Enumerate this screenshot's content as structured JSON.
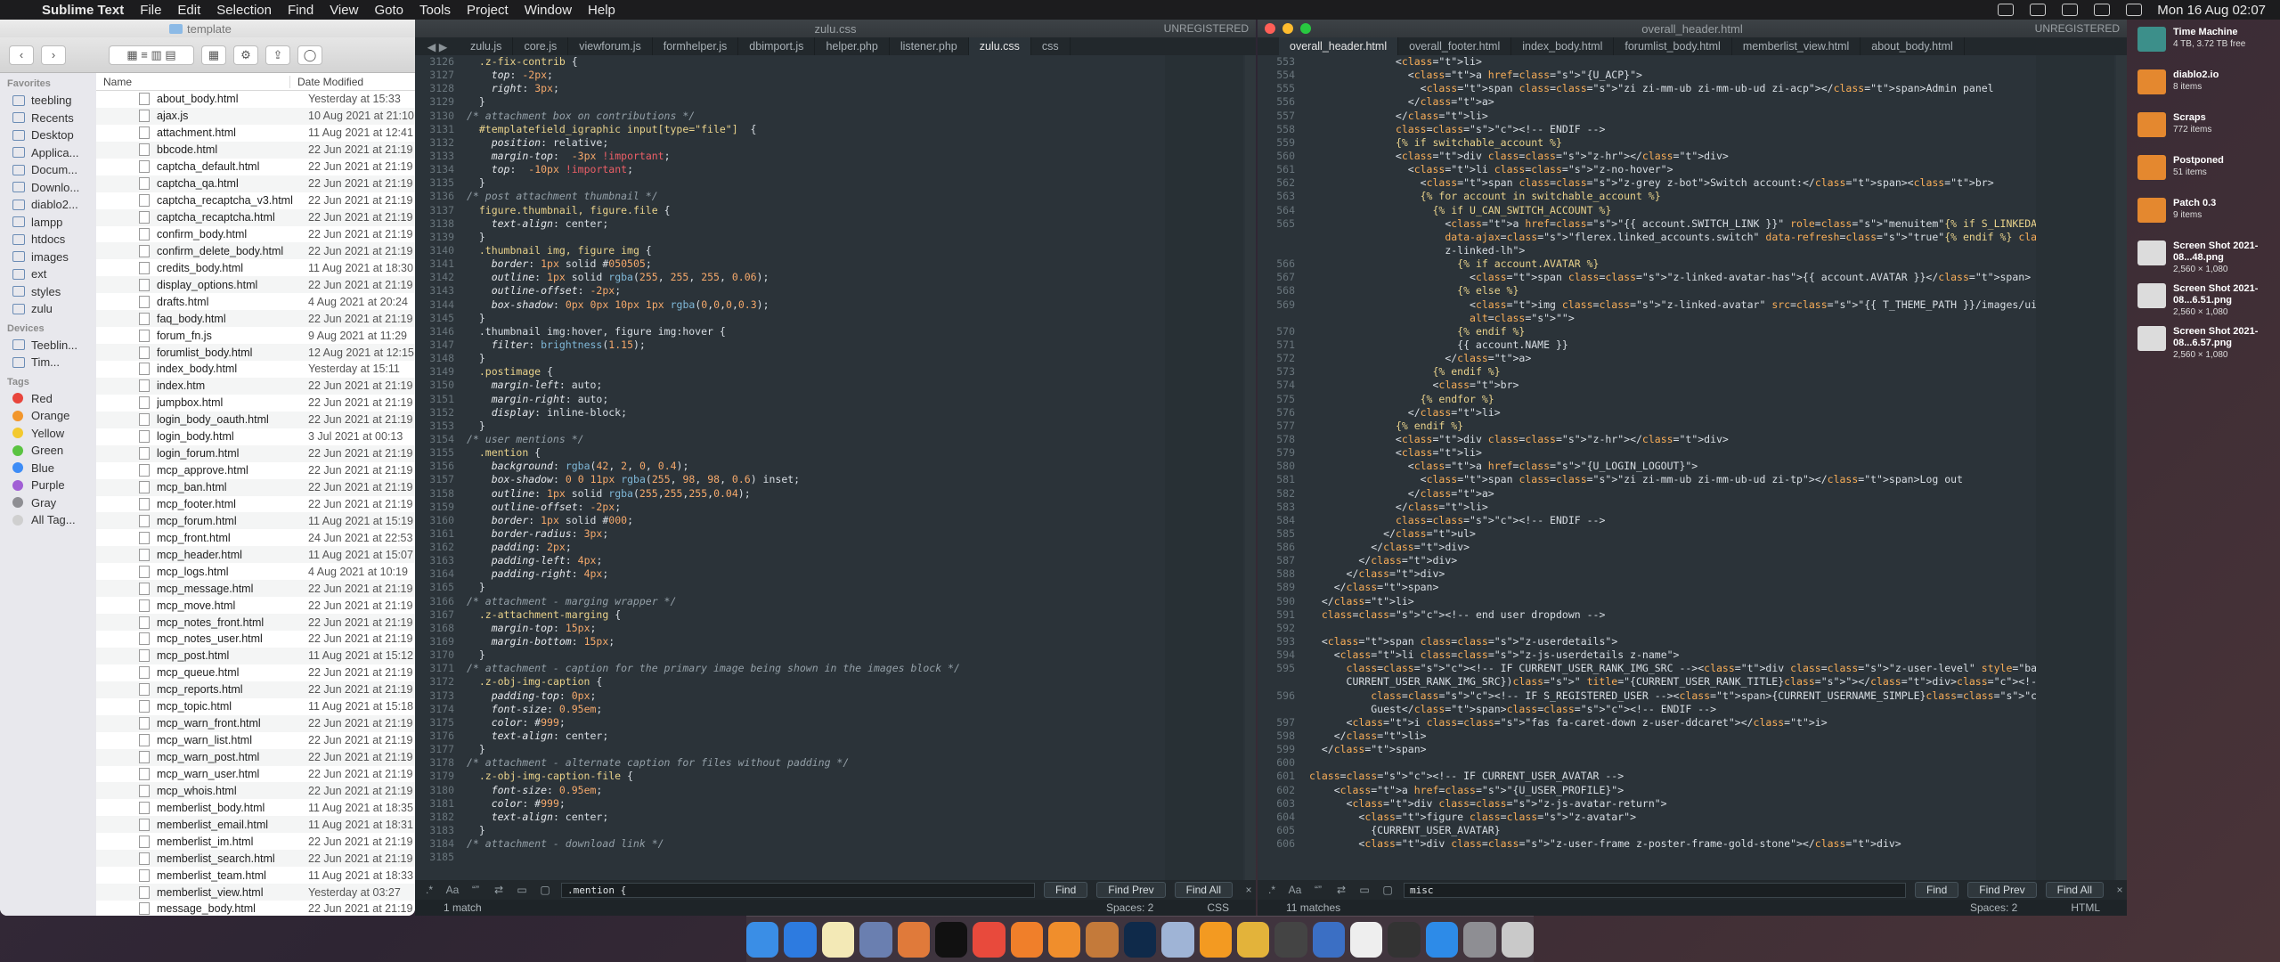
{
  "menubar": {
    "app": "Sublime Text",
    "menus": [
      "File",
      "Edit",
      "Selection",
      "Find",
      "View",
      "Goto",
      "Tools",
      "Project",
      "Window",
      "Help"
    ],
    "clock": "Mon 16 Aug  02:07"
  },
  "finder": {
    "title": "template",
    "columns": {
      "name": "Name",
      "date": "Date Modified"
    },
    "sidebar": {
      "favorites_label": "Favorites",
      "favorites": [
        "teebling",
        "Recents",
        "Desktop",
        "Applica...",
        "Docum...",
        "Downlo...",
        "diablo2...",
        "lampp",
        "htdocs",
        "images",
        "ext",
        "styles",
        "zulu"
      ],
      "devices_label": "Devices",
      "devices": [
        "Teeblin...",
        "Tim..."
      ],
      "tags_label": "Tags",
      "tags": [
        {
          "name": "Red",
          "color": "#e8453c"
        },
        {
          "name": "Orange",
          "color": "#f2962c"
        },
        {
          "name": "Yellow",
          "color": "#f3c92e"
        },
        {
          "name": "Green",
          "color": "#5ac341"
        },
        {
          "name": "Blue",
          "color": "#3d8cf6"
        },
        {
          "name": "Purple",
          "color": "#a15fd5"
        },
        {
          "name": "Gray",
          "color": "#8e8e93"
        },
        {
          "name": "All Tag...",
          "color": "#cfcfcf"
        }
      ]
    },
    "files": [
      {
        "name": "about_body.html",
        "date": "Yesterday at 15:33"
      },
      {
        "name": "ajax.js",
        "date": "10 Aug 2021 at 21:10"
      },
      {
        "name": "attachment.html",
        "date": "11 Aug 2021 at 12:41"
      },
      {
        "name": "bbcode.html",
        "date": "22 Jun 2021 at 21:19"
      },
      {
        "name": "captcha_default.html",
        "date": "22 Jun 2021 at 21:19"
      },
      {
        "name": "captcha_qa.html",
        "date": "22 Jun 2021 at 21:19"
      },
      {
        "name": "captcha_recaptcha_v3.html",
        "date": "22 Jun 2021 at 21:19"
      },
      {
        "name": "captcha_recaptcha.html",
        "date": "22 Jun 2021 at 21:19"
      },
      {
        "name": "confirm_body.html",
        "date": "22 Jun 2021 at 21:19"
      },
      {
        "name": "confirm_delete_body.html",
        "date": "22 Jun 2021 at 21:19"
      },
      {
        "name": "credits_body.html",
        "date": "11 Aug 2021 at 18:30"
      },
      {
        "name": "display_options.html",
        "date": "22 Jun 2021 at 21:19"
      },
      {
        "name": "drafts.html",
        "date": "4 Aug 2021 at 20:24"
      },
      {
        "name": "faq_body.html",
        "date": "22 Jun 2021 at 21:19"
      },
      {
        "name": "forum_fn.js",
        "date": "9 Aug 2021 at 11:29"
      },
      {
        "name": "forumlist_body.html",
        "date": "12 Aug 2021 at 12:15"
      },
      {
        "name": "index_body.html",
        "date": "Yesterday at 15:11"
      },
      {
        "name": "index.htm",
        "date": "22 Jun 2021 at 21:19"
      },
      {
        "name": "jumpbox.html",
        "date": "22 Jun 2021 at 21:19"
      },
      {
        "name": "login_body_oauth.html",
        "date": "22 Jun 2021 at 21:19"
      },
      {
        "name": "login_body.html",
        "date": "3 Jul 2021 at 00:13"
      },
      {
        "name": "login_forum.html",
        "date": "22 Jun 2021 at 21:19"
      },
      {
        "name": "mcp_approve.html",
        "date": "22 Jun 2021 at 21:19"
      },
      {
        "name": "mcp_ban.html",
        "date": "22 Jun 2021 at 21:19"
      },
      {
        "name": "mcp_footer.html",
        "date": "22 Jun 2021 at 21:19"
      },
      {
        "name": "mcp_forum.html",
        "date": "11 Aug 2021 at 15:19"
      },
      {
        "name": "mcp_front.html",
        "date": "24 Jun 2021 at 22:53"
      },
      {
        "name": "mcp_header.html",
        "date": "11 Aug 2021 at 15:07"
      },
      {
        "name": "mcp_logs.html",
        "date": "4 Aug 2021 at 10:19"
      },
      {
        "name": "mcp_message.html",
        "date": "22 Jun 2021 at 21:19"
      },
      {
        "name": "mcp_move.html",
        "date": "22 Jun 2021 at 21:19"
      },
      {
        "name": "mcp_notes_front.html",
        "date": "22 Jun 2021 at 21:19"
      },
      {
        "name": "mcp_notes_user.html",
        "date": "22 Jun 2021 at 21:19"
      },
      {
        "name": "mcp_post.html",
        "date": "11 Aug 2021 at 15:12"
      },
      {
        "name": "mcp_queue.html",
        "date": "22 Jun 2021 at 21:19"
      },
      {
        "name": "mcp_reports.html",
        "date": "22 Jun 2021 at 21:19"
      },
      {
        "name": "mcp_topic.html",
        "date": "11 Aug 2021 at 15:18"
      },
      {
        "name": "mcp_warn_front.html",
        "date": "22 Jun 2021 at 21:19"
      },
      {
        "name": "mcp_warn_list.html",
        "date": "22 Jun 2021 at 21:19"
      },
      {
        "name": "mcp_warn_post.html",
        "date": "22 Jun 2021 at 21:19"
      },
      {
        "name": "mcp_warn_user.html",
        "date": "22 Jun 2021 at 21:19"
      },
      {
        "name": "mcp_whois.html",
        "date": "22 Jun 2021 at 21:19"
      },
      {
        "name": "memberlist_body.html",
        "date": "11 Aug 2021 at 18:35"
      },
      {
        "name": "memberlist_email.html",
        "date": "11 Aug 2021 at 18:31"
      },
      {
        "name": "memberlist_im.html",
        "date": "22 Jun 2021 at 21:19"
      },
      {
        "name": "memberlist_search.html",
        "date": "22 Jun 2021 at 21:19"
      },
      {
        "name": "memberlist_team.html",
        "date": "11 Aug 2021 at 18:33"
      },
      {
        "name": "memberlist_view.html",
        "date": "Yesterday at 03:27"
      },
      {
        "name": "message_body.html",
        "date": "22 Jun 2021 at 21:19"
      }
    ]
  },
  "editor_left": {
    "window_title": "zulu.css",
    "unregistered": "UNREGISTERED",
    "tabs": [
      "zulu.js",
      "core.js",
      "viewforum.js",
      "formhelper.js",
      "dbimport.js",
      "helper.php",
      "listener.php",
      "zulu.css",
      "css"
    ],
    "active_tab": "zulu.css",
    "find_value": ".mention {",
    "find_buttons": [
      "Find",
      "Find Prev",
      "Find All"
    ],
    "status": {
      "matches": "1 match",
      "spaces": "Spaces: 2",
      "syntax": "CSS"
    },
    "line_numbers": [
      "3126",
      "3127",
      "3128",
      "3129",
      "3130",
      "3131",
      "3132",
      "3133",
      "3134",
      "3135",
      "3136",
      "3137",
      "3138",
      "3139",
      "3140",
      "3141",
      "3142",
      "3143",
      "3144",
      "3145",
      "3146",
      "3147",
      "3148",
      "3149",
      "3150",
      "3151",
      "3152",
      "3153",
      "3154",
      "3155",
      "3156",
      "3157",
      "3158",
      "3159",
      "3160",
      "3161",
      "3162",
      "3163",
      "3164",
      "3165",
      "3166",
      "3167",
      "3168",
      "3169",
      "3170",
      "3171",
      "3172",
      "3173",
      "3174",
      "3175",
      "3176",
      "3177",
      "3178",
      "3179",
      "3180",
      "3181",
      "3182",
      "3183",
      "3184",
      "3185"
    ],
    "lines": [
      "  .z-fix-contrib {",
      "    top: -2px;",
      "    right: 3px;",
      "  }",
      "/* attachment box on contributions */",
      "  #templatefield_igraphic input[type=\"file\"]  {",
      "    position: relative;",
      "    margin-top:  -3px !important;",
      "    top:  -10px !important;",
      "  }",
      "/* post attachment thumbnail */",
      "  figure.thumbnail, figure.file {",
      "    text-align: center;",
      "  }",
      "  .thumbnail img, figure img {",
      "    border: 1px solid #050505;",
      "    outline: 1px solid rgba(255, 255, 255, 0.06);",
      "    outline-offset: -2px;",
      "    box-shadow: 0px 0px 10px 1px rgba(0,0,0,0.3);",
      "  }",
      "  .thumbnail img:hover, figure img:hover {",
      "    filter: brightness(1.15);",
      "  }",
      "  .postimage {",
      "    margin-left: auto;",
      "    margin-right: auto;",
      "    display: inline-block;",
      "  }",
      "/* user mentions */",
      "  .mention {",
      "    background: rgba(42, 2, 0, 0.4);",
      "    box-shadow: 0 0 11px rgba(255, 98, 98, 0.6) inset;",
      "    outline: 1px solid rgba(255,255,255,0.04);",
      "    outline-offset: -2px;",
      "    border: 1px solid #000;",
      "    border-radius: 3px;",
      "    padding: 2px;",
      "    padding-left: 4px;",
      "    padding-right: 4px;",
      "  }",
      "/* attachment - marging wrapper */",
      "  .z-attachment-marging {",
      "    margin-top: 15px;",
      "    margin-bottom: 15px;",
      "  }",
      "/* attachment - caption for the primary image being shown in the images block */",
      "  .z-obj-img-caption {",
      "    padding-top: 0px;",
      "    font-size: 0.95em;",
      "    color: #999;",
      "    text-align: center;",
      "  }",
      "/* attachment - alternate caption for files without padding */",
      "  .z-obj-img-caption-file {",
      "    font-size: 0.95em;",
      "    color: #999;",
      "    text-align: center;",
      "  }",
      "/* attachment - download link */",
      ""
    ]
  },
  "editor_right": {
    "window_title": "overall_header.html",
    "unregistered": "UNREGISTERED",
    "tabs": [
      "overall_header.html",
      "overall_footer.html",
      "index_body.html",
      "forumlist_body.html",
      "memberlist_view.html",
      "about_body.html"
    ],
    "active_tab": "overall_header.html",
    "find_value": "misc",
    "find_buttons": [
      "Find",
      "Find Prev",
      "Find All"
    ],
    "status": {
      "matches": "11 matches",
      "spaces": "Spaces: 2",
      "syntax": "HTML"
    },
    "line_numbers": [
      "553",
      "554",
      "555",
      "556",
      "557",
      "558",
      "559",
      "560",
      "561",
      "562",
      "563",
      "564",
      "565",
      "",
      "",
      "566",
      "567",
      "568",
      "569",
      "",
      "570",
      "571",
      "572",
      "573",
      "574",
      "575",
      "576",
      "577",
      "578",
      "579",
      "580",
      "581",
      "582",
      "583",
      "584",
      "585",
      "586",
      "587",
      "588",
      "589",
      "590",
      "591",
      "592",
      "593",
      "594",
      "595",
      "",
      "596",
      "",
      "597",
      "598",
      "599",
      "600",
      "601",
      "602",
      "603",
      "604",
      "605",
      "606"
    ],
    "lines": [
      "              <li>",
      "                <a href=\"{U_ACP}\">",
      "                  <span class=\"zi zi-mm-ub zi-mm-ub-ud zi-acp\"></span>Admin panel",
      "                </a>",
      "              </li>",
      "              <!-- ENDIF -->",
      "              {% if switchable_account %}",
      "              <div class=\"z-hr\"></div>",
      "                <li class=\"z-no-hover\">",
      "                  <span class=\"z-grey z-bot\">Switch account:</span><br>",
      "                  {% for account in switchable_account %}",
      "                    {% if U_CAN_SWITCH_ACCOUNT %}",
      "                      <a href=\"{{ account.SWITCH_LINK }}\" role=\"menuitem\"{% if S_LINKEDACCOUNTS_AJAX %}",
      "                      data-ajax=\"flerex.linked_accounts.switch\" data-refresh=\"true\"{% endif %} class=\"",
      "                      z-linked-lh\">",
      "                        {% if account.AVATAR %}",
      "                          <span class=\"z-linked-avatar-has\">{{ account.AVATAR }}</span>",
      "                        {% else %}",
      "                          <img class=\"z-linked-avatar\" src=\"{{ T_THEME_PATH }}/images/ui/no_avatar.png\"",
      "                          alt=\"\">",
      "                        {% endif %}",
      "                        {{ account.NAME }}",
      "                      </a>",
      "                    {% endif %}",
      "                    <br>",
      "                  {% endfor %}",
      "                </li>",
      "              {% endif %}",
      "              <div class=\"z-hr\"></div>",
      "              <li>",
      "                <a href=\"{U_LOGIN_LOGOUT}\">",
      "                  <span class=\"zi zi-mm-ub zi-mm-ub-ud zi-tp\"></span>Log out",
      "                </a>",
      "              </li>",
      "              <!-- ENDIF -->",
      "            </ul>",
      "          </div>",
      "        </div>",
      "      </div>",
      "    </span>",
      "  </li>",
      "  <!-- end user dropdown -->",
      "",
      "  <span class=\"z-userdetails\">",
      "    <li class=\"z-js-userdetails z-name\">",
      "      <!-- IF CURRENT_USER_RANK_IMG_SRC --><div class=\"z-user-level\" style=\"background-image: url({",
      "      CURRENT_USER_RANK_IMG_SRC})\" title=\"{CURRENT_USER_RANK_TITLE}\"></div><!-- ENDIF -->",
      "          <!-- IF S_REGISTERED_USER --><span>{CURRENT_USERNAME_SIMPLE}<!-- ELSE --><span class=\"z-bone\">",
      "          Guest</span><!-- ENDIF -->",
      "      <i class=\"fas fa-caret-down z-user-ddcaret\"></i>",
      "    </li>",
      "  </span>",
      "",
      "<!-- IF CURRENT_USER_AVATAR -->",
      "    <a href=\"{U_USER_PROFILE}\">",
      "      <div class=\"z-js-avatar-return\">",
      "        <figure class=\"z-avatar\">",
      "          {CURRENT_USER_AVATAR}",
      "        <div class=\"z-user-frame z-poster-frame-gold-stone\"></div>"
    ]
  },
  "desktop_items": [
    {
      "name": "Time Machine",
      "sub": "4 TB, 3.72 TB free"
    },
    {
      "name": "diablo2.io",
      "sub": "8 items"
    },
    {
      "name": "Scraps",
      "sub": "772 items"
    },
    {
      "name": "Postponed",
      "sub": "51 items"
    },
    {
      "name": "Patch 0.3",
      "sub": "9 items"
    },
    {
      "name": "Screen Shot 2021-08...48.png",
      "sub": "2,560 × 1,080"
    },
    {
      "name": "Screen Shot 2021-08...6.51.png",
      "sub": "2,560 × 1,080"
    },
    {
      "name": "Screen Shot 2021-08...6.57.png",
      "sub": "2,560 × 1,080"
    }
  ],
  "dock": {
    "apps": [
      {
        "name": "finder-icon",
        "color": "#3a8ee6"
      },
      {
        "name": "safari-icon",
        "color": "#2d7be0"
      },
      {
        "name": "notes-icon",
        "color": "#f3e9b6"
      },
      {
        "name": "stack-icon",
        "color": "#6a7fb0"
      },
      {
        "name": "transmit-icon",
        "color": "#e07a3a"
      },
      {
        "name": "terminal-icon",
        "color": "#111111"
      },
      {
        "name": "chrome-icon",
        "color": "#e84a3c"
      },
      {
        "name": "firefox-icon",
        "color": "#f07f2a"
      },
      {
        "name": "sublime-icon",
        "color": "#f08e2c"
      },
      {
        "name": "image-icon",
        "color": "#c47a3a"
      },
      {
        "name": "photoshop-icon",
        "color": "#0f2a4a"
      },
      {
        "name": "preview-icon",
        "color": "#9fb4d6"
      },
      {
        "name": "vlc-icon",
        "color": "#f39a21"
      },
      {
        "name": "pineapple-icon",
        "color": "#e3b33a"
      },
      {
        "name": "wizard-icon",
        "color": "#444444"
      },
      {
        "name": "xcode-icon",
        "color": "#3b6fc4"
      },
      {
        "name": "script-icon",
        "color": "#eeeeee"
      },
      {
        "name": "film-icon",
        "color": "#333333"
      },
      {
        "name": "appstore-icon",
        "color": "#2d8be8"
      },
      {
        "name": "settings-icon",
        "color": "#8e8e93"
      },
      {
        "name": "trash-icon",
        "color": "#c9c9c9"
      }
    ]
  }
}
